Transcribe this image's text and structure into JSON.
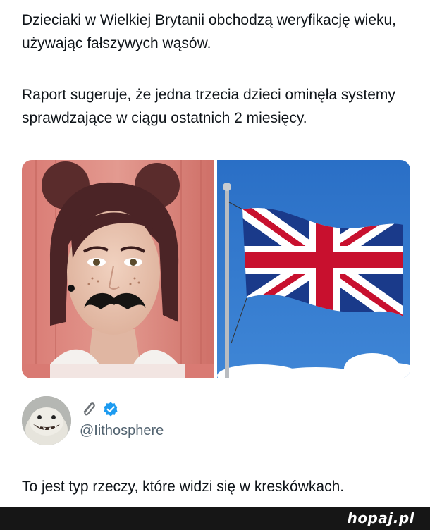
{
  "post": {
    "headline": "Dzieciaki w Wielkiej Brytanii obchodzą weryfikację wieku, używając fałszywych wąsów.",
    "body": "Raport sugeruje, że jedna trzecia dzieci ominęła systemy sprawdzające w ciągu ostatnich 2 miesięcy.",
    "media": [
      {
        "subject": "girl-with-fake-moustache"
      },
      {
        "subject": "union-jack-flag"
      }
    ]
  },
  "reply": {
    "avatar_icon": "avatar-icon",
    "badges": [
      "paperclip-icon",
      "verified-badge-icon"
    ],
    "badge_color": "#1d9bf0",
    "handle": "@Iithosphere",
    "text": "To jest typ rzeczy, które widzi się w kreskówkach."
  },
  "footer": {
    "logo": "hopaj.pl"
  }
}
